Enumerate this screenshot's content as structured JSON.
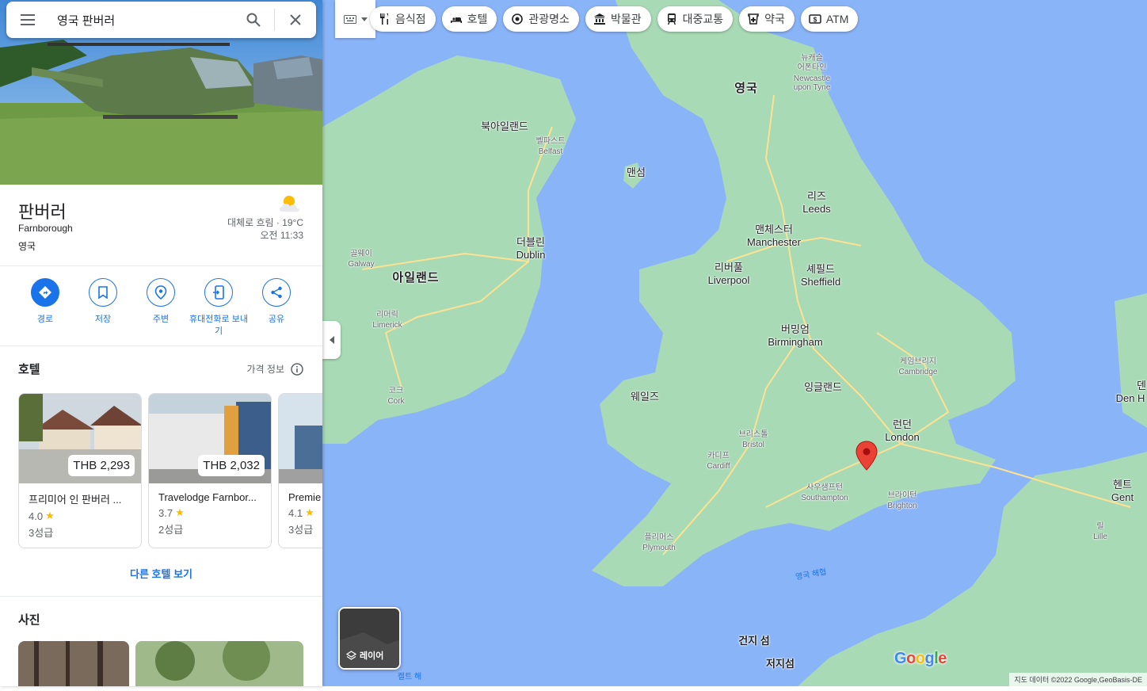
{
  "search": {
    "value": "영국 판버러",
    "menu_icon": "hamburger-icon",
    "search_icon": "search-icon",
    "clear_icon": "close-icon"
  },
  "place": {
    "name": "판버러",
    "name_en": "Farnborough",
    "country": "영국",
    "weather": {
      "condition": "대체로 흐림 · 19°C",
      "time": "오전 11:33",
      "icon": "partly-cloudy-icon"
    }
  },
  "actions": [
    {
      "label": "경로",
      "icon": "directions-icon"
    },
    {
      "label": "저장",
      "icon": "bookmark-icon"
    },
    {
      "label": "주변",
      "icon": "nearby-icon"
    },
    {
      "label": "휴대전화로 보내기",
      "icon": "send-to-phone-icon"
    },
    {
      "label": "공유",
      "icon": "share-icon"
    }
  ],
  "hotels": {
    "title": "호텔",
    "price_info": "가격 정보",
    "items": [
      {
        "name": "프리미어 인 판버러 ...",
        "price": "THB 2,293",
        "rating": "4.0",
        "class": "3성급"
      },
      {
        "name": "Travelodge Farnbor...",
        "price": "THB 2,032",
        "rating": "3.7",
        "class": "2성급"
      },
      {
        "name": "Premie",
        "price": "",
        "rating": "4.1",
        "class": "3성급"
      }
    ],
    "more": "다른 호텔 보기"
  },
  "photos": {
    "title": "사진"
  },
  "map": {
    "categories": [
      {
        "label": "음식점",
        "icon": "restaurant-icon"
      },
      {
        "label": "호텔",
        "icon": "hotel-icon"
      },
      {
        "label": "관광명소",
        "icon": "attraction-icon"
      },
      {
        "label": "박물관",
        "icon": "museum-icon"
      },
      {
        "label": "대중교통",
        "icon": "transit-icon"
      },
      {
        "label": "약국",
        "icon": "pharmacy-icon"
      },
      {
        "label": "ATM",
        "icon": "atm-icon"
      }
    ],
    "labels": {
      "uk": "영국",
      "newcastle_ko": "뉴캐슬",
      "newcastle_ko2": "어폰타인",
      "newcastle_en": "Newcastle",
      "newcastle_en2": "upon Tyne",
      "ni": "북아일랜드",
      "belfast_ko": "벨파스트",
      "belfast_en": "Belfast",
      "iom": "맨섬",
      "leeds_ko": "리즈",
      "leeds_en": "Leeds",
      "manchester_ko": "맨체스터",
      "manchester_en": "Manchester",
      "liverpool_ko": "리버풀",
      "liverpool_en": "Liverpool",
      "sheffield_ko": "셰필드",
      "sheffield_en": "Sheffield",
      "dublin_ko": "더블린",
      "dublin_en": "Dublin",
      "galway_ko": "골웨이",
      "galway_en": "Galway",
      "ireland": "아일랜드",
      "limerick_ko": "리머릭",
      "limerick_en": "Limerick",
      "birmingham_ko": "버밍엄",
      "birmingham_en": "Birmingham",
      "cambridge_ko": "케임브리지",
      "cambridge_en": "Cambridge",
      "england": "잉글랜드",
      "cork_ko": "코크",
      "cork_en": "Cork",
      "wales": "웨일즈",
      "bristol_ko": "브리스톨",
      "bristol_en": "Bristol",
      "cardiff_ko": "카디프",
      "cardiff_en": "Cardiff",
      "london_ko": "런던",
      "london_en": "London",
      "southampton_ko": "사우샘프턴",
      "southampton_en": "Southampton",
      "brighton_ko": "브라이턴",
      "brighton_en": "Brighton",
      "plymouth_ko": "플리머스",
      "plymouth_en": "Plymouth",
      "channel": "영국 해협",
      "celtic": "켈트 해",
      "gent_ko": "헨트",
      "gent_en": "Gent",
      "lille_ko": "릴",
      "lille_en": "Lille",
      "denh_ko": "덴",
      "denh_en": "Den H",
      "jersey": "건지 섬",
      "jersey2": "저지섬"
    },
    "layer_label": "레이어",
    "attribution": "지도 데이터 ©2022 Google,GeoBasis-DE",
    "google": [
      "G",
      "o",
      "o",
      "g",
      "l",
      "e"
    ]
  },
  "colors": {
    "accent": "#1a73e8",
    "water": "#8ab4f8",
    "land": "#a8dab5",
    "road": "#fde293",
    "pin": "#ea4335"
  }
}
